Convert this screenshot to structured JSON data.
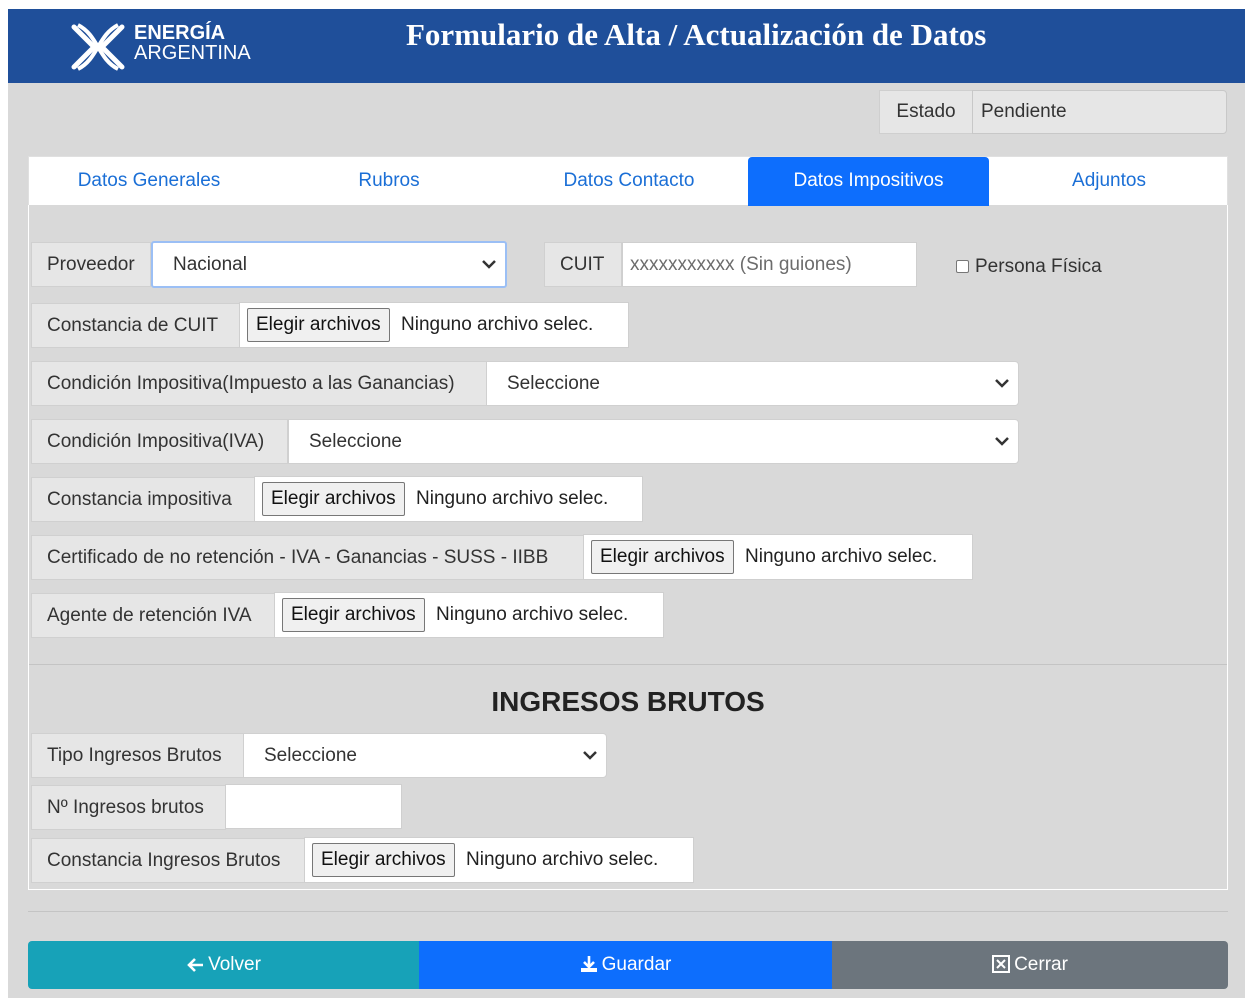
{
  "header": {
    "logo_line1": "ENERGÍA",
    "logo_line2": "ARGENTINA",
    "title": "Formulario de Alta / Actualización de Datos",
    "color": "#1f4f9a"
  },
  "estado": {
    "label": "Estado",
    "value": "Pendiente"
  },
  "tabs": [
    {
      "label": "Datos Generales",
      "active": false
    },
    {
      "label": "Rubros",
      "active": false
    },
    {
      "label": "Datos Contacto",
      "active": false
    },
    {
      "label": "Datos Impositivos",
      "active": true
    },
    {
      "label": "Adjuntos",
      "active": false
    }
  ],
  "form": {
    "proveedor": {
      "label": "Proveedor",
      "value": "Nacional"
    },
    "cuit": {
      "label": "CUIT",
      "placeholder": "xxxxxxxxxxx (Sin guiones)"
    },
    "persona_fisica": {
      "label": "Persona Física",
      "checked": false
    },
    "constancia_cuit": {
      "label": "Constancia de CUIT",
      "button": "Elegir archivos",
      "status": "Ninguno archivo selec."
    },
    "cond_ganancias": {
      "label": "Condición Impositiva(Impuesto a las Ganancias)",
      "value": "Seleccione"
    },
    "cond_iva": {
      "label": "Condición Impositiva(IVA)",
      "value": "Seleccione"
    },
    "constancia_impositiva": {
      "label": "Constancia impositiva",
      "button": "Elegir archivos",
      "status": "Ninguno archivo selec."
    },
    "cert_no_retencion": {
      "label": "Certificado de no retención - IVA - Ganancias - SUSS - IIBB",
      "button": "Elegir archivos",
      "status": "Ninguno archivo selec."
    },
    "agente_retencion": {
      "label": "Agente de retención IVA",
      "button": "Elegir archivos",
      "status": "Ninguno archivo selec."
    }
  },
  "ingresos_brutos": {
    "title": "INGRESOS BRUTOS",
    "tipo": {
      "label": "Tipo Ingresos Brutos",
      "value": "Seleccione"
    },
    "numero": {
      "label": "Nº Ingresos brutos",
      "value": ""
    },
    "constancia": {
      "label": "Constancia Ingresos Brutos",
      "button": "Elegir archivos",
      "status": "Ninguno archivo selec."
    }
  },
  "actions": {
    "volver": {
      "label": "Volver",
      "icon": "arrow-left-icon",
      "color": "#17a2b8"
    },
    "guardar": {
      "label": "Guardar",
      "icon": "download-icon",
      "color": "#0d6efd"
    },
    "cerrar": {
      "label": "Cerrar",
      "icon": "x-square-icon",
      "color": "#6c757d"
    }
  }
}
